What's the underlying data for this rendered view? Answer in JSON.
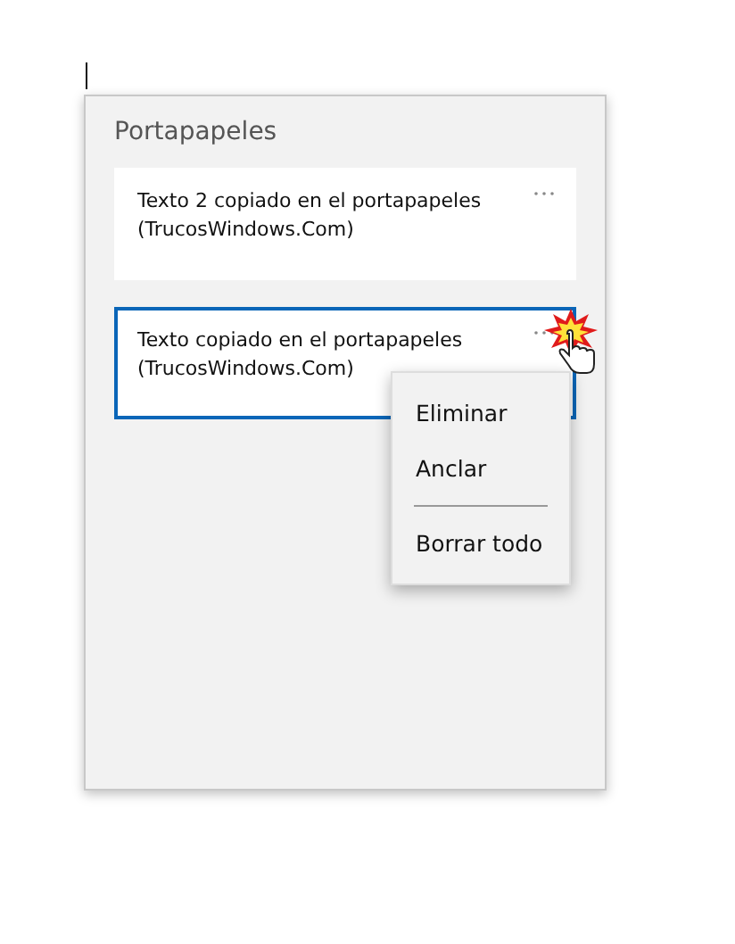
{
  "clipboard": {
    "title": "Portapapeles",
    "items": [
      {
        "text": "Texto 2 copiado en el portapapeles\n(TrucosWindows.Com)",
        "selected": false
      },
      {
        "text": "Texto copiado en el portapapeles\n(TrucosWindows.Com)",
        "selected": true
      }
    ]
  },
  "context_menu": {
    "items": [
      {
        "kind": "item",
        "label": "Eliminar"
      },
      {
        "kind": "item",
        "label": "Anclar"
      },
      {
        "kind": "separator"
      },
      {
        "kind": "item",
        "label": "Borrar todo"
      }
    ]
  }
}
